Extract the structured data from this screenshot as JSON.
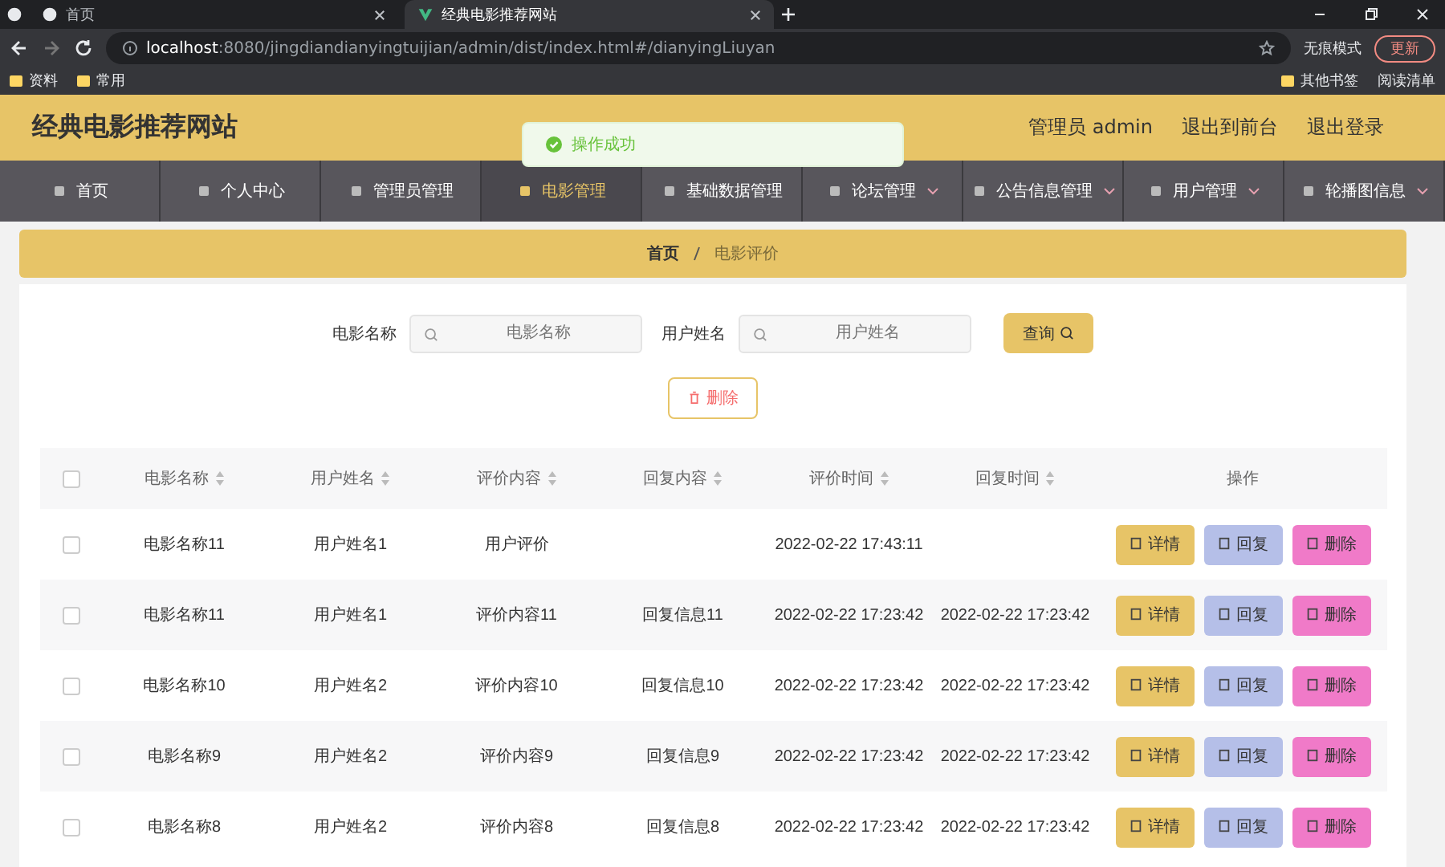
{
  "browser": {
    "tabs": [
      {
        "title": "首页",
        "selected": false
      },
      {
        "title": "经典电影推荐网站",
        "selected": true
      }
    ],
    "url_host": "localhost",
    "url_rest": ":8080/jingdiandianyingtuijian/admin/dist/index.html#/dianyingLiuyan",
    "incognito": "无痕模式",
    "update": "更新",
    "bookmarks": [
      "资料",
      "常用"
    ],
    "other_bookmarks": "其他书签",
    "reading_list": "阅读清单"
  },
  "header": {
    "title": "经典电影推荐网站",
    "user": "管理员 admin",
    "links": [
      "退出到前台",
      "退出登录"
    ]
  },
  "toast": "操作成功",
  "nav": [
    {
      "label": "首页",
      "selected": false,
      "dropdown": false
    },
    {
      "label": "个人中心",
      "selected": false,
      "dropdown": false
    },
    {
      "label": "管理员管理",
      "selected": false,
      "dropdown": false
    },
    {
      "label": "电影管理",
      "selected": true,
      "dropdown": false
    },
    {
      "label": "基础数据管理",
      "selected": false,
      "dropdown": false
    },
    {
      "label": "论坛管理",
      "selected": false,
      "dropdown": true
    },
    {
      "label": "公告信息管理",
      "selected": false,
      "dropdown": true
    },
    {
      "label": "用户管理",
      "selected": false,
      "dropdown": true
    },
    {
      "label": "轮播图信息",
      "selected": false,
      "dropdown": true
    }
  ],
  "breadcrumb": [
    "首页",
    "电影评价"
  ],
  "search": {
    "fields": [
      {
        "label": "电影名称",
        "placeholder": "电影名称"
      },
      {
        "label": "用户姓名",
        "placeholder": "用户姓名"
      }
    ],
    "button": "查询"
  },
  "delete_button": "删除",
  "table": {
    "select_all_checked": false,
    "columns": [
      "电影名称",
      "用户姓名",
      "评价内容",
      "回复内容",
      "评价时间",
      "回复时间"
    ],
    "actions_column": "操作",
    "rows": [
      {
        "checked": false,
        "cells": [
          "电影名称11",
          "用户姓名1",
          "用户评价",
          "",
          "2022-02-22 17:43:11",
          ""
        ],
        "actions": [
          "详情",
          "回复",
          "删除"
        ]
      },
      {
        "checked": false,
        "cells": [
          "电影名称11",
          "用户姓名1",
          "评价内容11",
          "回复信息11",
          "2022-02-22 17:23:42",
          "2022-02-22 17:23:42"
        ],
        "actions": [
          "详情",
          "回复",
          "删除"
        ]
      },
      {
        "checked": false,
        "cells": [
          "电影名称10",
          "用户姓名2",
          "评价内容10",
          "回复信息10",
          "2022-02-22 17:23:42",
          "2022-02-22 17:23:42"
        ],
        "actions": [
          "详情",
          "回复",
          "删除"
        ]
      },
      {
        "checked": false,
        "cells": [
          "电影名称9",
          "用户姓名2",
          "评价内容9",
          "回复信息9",
          "2022-02-22 17:23:42",
          "2022-02-22 17:23:42"
        ],
        "actions": [
          "详情",
          "回复",
          "删除"
        ]
      },
      {
        "checked": false,
        "cells": [
          "电影名称8",
          "用户姓名2",
          "评价内容8",
          "回复信息8",
          "2022-02-22 17:23:42",
          "2022-02-22 17:23:42"
        ],
        "actions": [
          "详情",
          "回复",
          "删除"
        ]
      }
    ]
  }
}
